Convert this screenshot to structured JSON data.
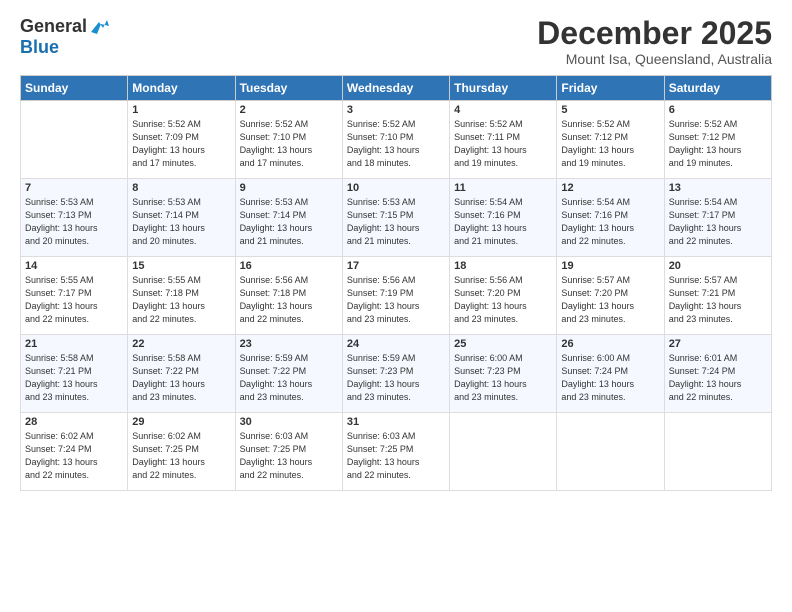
{
  "logo": {
    "general": "General",
    "blue": "Blue"
  },
  "title": "December 2025",
  "location": "Mount Isa, Queensland, Australia",
  "headers": [
    "Sunday",
    "Monday",
    "Tuesday",
    "Wednesday",
    "Thursday",
    "Friday",
    "Saturday"
  ],
  "weeks": [
    [
      {
        "day": "",
        "info": ""
      },
      {
        "day": "1",
        "info": "Sunrise: 5:52 AM\nSunset: 7:09 PM\nDaylight: 13 hours\nand 17 minutes."
      },
      {
        "day": "2",
        "info": "Sunrise: 5:52 AM\nSunset: 7:10 PM\nDaylight: 13 hours\nand 17 minutes."
      },
      {
        "day": "3",
        "info": "Sunrise: 5:52 AM\nSunset: 7:10 PM\nDaylight: 13 hours\nand 18 minutes."
      },
      {
        "day": "4",
        "info": "Sunrise: 5:52 AM\nSunset: 7:11 PM\nDaylight: 13 hours\nand 19 minutes."
      },
      {
        "day": "5",
        "info": "Sunrise: 5:52 AM\nSunset: 7:12 PM\nDaylight: 13 hours\nand 19 minutes."
      },
      {
        "day": "6",
        "info": "Sunrise: 5:52 AM\nSunset: 7:12 PM\nDaylight: 13 hours\nand 19 minutes."
      }
    ],
    [
      {
        "day": "7",
        "info": "Sunrise: 5:53 AM\nSunset: 7:13 PM\nDaylight: 13 hours\nand 20 minutes."
      },
      {
        "day": "8",
        "info": "Sunrise: 5:53 AM\nSunset: 7:14 PM\nDaylight: 13 hours\nand 20 minutes."
      },
      {
        "day": "9",
        "info": "Sunrise: 5:53 AM\nSunset: 7:14 PM\nDaylight: 13 hours\nand 21 minutes."
      },
      {
        "day": "10",
        "info": "Sunrise: 5:53 AM\nSunset: 7:15 PM\nDaylight: 13 hours\nand 21 minutes."
      },
      {
        "day": "11",
        "info": "Sunrise: 5:54 AM\nSunset: 7:16 PM\nDaylight: 13 hours\nand 21 minutes."
      },
      {
        "day": "12",
        "info": "Sunrise: 5:54 AM\nSunset: 7:16 PM\nDaylight: 13 hours\nand 22 minutes."
      },
      {
        "day": "13",
        "info": "Sunrise: 5:54 AM\nSunset: 7:17 PM\nDaylight: 13 hours\nand 22 minutes."
      }
    ],
    [
      {
        "day": "14",
        "info": "Sunrise: 5:55 AM\nSunset: 7:17 PM\nDaylight: 13 hours\nand 22 minutes."
      },
      {
        "day": "15",
        "info": "Sunrise: 5:55 AM\nSunset: 7:18 PM\nDaylight: 13 hours\nand 22 minutes."
      },
      {
        "day": "16",
        "info": "Sunrise: 5:56 AM\nSunset: 7:18 PM\nDaylight: 13 hours\nand 22 minutes."
      },
      {
        "day": "17",
        "info": "Sunrise: 5:56 AM\nSunset: 7:19 PM\nDaylight: 13 hours\nand 23 minutes."
      },
      {
        "day": "18",
        "info": "Sunrise: 5:56 AM\nSunset: 7:20 PM\nDaylight: 13 hours\nand 23 minutes."
      },
      {
        "day": "19",
        "info": "Sunrise: 5:57 AM\nSunset: 7:20 PM\nDaylight: 13 hours\nand 23 minutes."
      },
      {
        "day": "20",
        "info": "Sunrise: 5:57 AM\nSunset: 7:21 PM\nDaylight: 13 hours\nand 23 minutes."
      }
    ],
    [
      {
        "day": "21",
        "info": "Sunrise: 5:58 AM\nSunset: 7:21 PM\nDaylight: 13 hours\nand 23 minutes."
      },
      {
        "day": "22",
        "info": "Sunrise: 5:58 AM\nSunset: 7:22 PM\nDaylight: 13 hours\nand 23 minutes."
      },
      {
        "day": "23",
        "info": "Sunrise: 5:59 AM\nSunset: 7:22 PM\nDaylight: 13 hours\nand 23 minutes."
      },
      {
        "day": "24",
        "info": "Sunrise: 5:59 AM\nSunset: 7:23 PM\nDaylight: 13 hours\nand 23 minutes."
      },
      {
        "day": "25",
        "info": "Sunrise: 6:00 AM\nSunset: 7:23 PM\nDaylight: 13 hours\nand 23 minutes."
      },
      {
        "day": "26",
        "info": "Sunrise: 6:00 AM\nSunset: 7:24 PM\nDaylight: 13 hours\nand 23 minutes."
      },
      {
        "day": "27",
        "info": "Sunrise: 6:01 AM\nSunset: 7:24 PM\nDaylight: 13 hours\nand 22 minutes."
      }
    ],
    [
      {
        "day": "28",
        "info": "Sunrise: 6:02 AM\nSunset: 7:24 PM\nDaylight: 13 hours\nand 22 minutes."
      },
      {
        "day": "29",
        "info": "Sunrise: 6:02 AM\nSunset: 7:25 PM\nDaylight: 13 hours\nand 22 minutes."
      },
      {
        "day": "30",
        "info": "Sunrise: 6:03 AM\nSunset: 7:25 PM\nDaylight: 13 hours\nand 22 minutes."
      },
      {
        "day": "31",
        "info": "Sunrise: 6:03 AM\nSunset: 7:25 PM\nDaylight: 13 hours\nand 22 minutes."
      },
      {
        "day": "",
        "info": ""
      },
      {
        "day": "",
        "info": ""
      },
      {
        "day": "",
        "info": ""
      }
    ]
  ]
}
